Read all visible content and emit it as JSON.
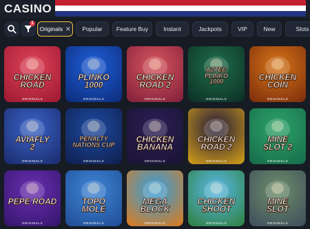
{
  "header": {
    "title": "CASINO"
  },
  "filters": {
    "badge": "1",
    "chips": [
      {
        "label": "Originals",
        "active": true
      },
      {
        "label": "Popular",
        "active": false
      },
      {
        "label": "Feature Buy",
        "active": false
      },
      {
        "label": "Instant",
        "active": false
      },
      {
        "label": "Jackpots",
        "active": false
      },
      {
        "label": "VIP",
        "active": false
      },
      {
        "label": "New",
        "active": false
      },
      {
        "label": "Slots",
        "active": false
      }
    ]
  },
  "games": [
    {
      "title": "CHICKEN\nROAD",
      "tag": "ORIGINALS",
      "bg": "#e0445a",
      "bg2": "#9c1830"
    },
    {
      "title": "PLINKO\n1000",
      "tag": "ORIGINALS",
      "bg": "#1f5fd8",
      "bg2": "#0c2b7a"
    },
    {
      "title": "CHICKEN\nROAD 2",
      "tag": "ORIGINALS",
      "bg": "#d9565e",
      "bg2": "#7f1f3a"
    },
    {
      "title": "AZTEC\nPLINKO\n1000",
      "tag": "ORIGINALS",
      "bg": "#1f6e4c",
      "bg2": "#0c2e24"
    },
    {
      "title": "CHICKEN\nCOIN",
      "tag": "ORIGINALS",
      "bg": "#d77518",
      "bg2": "#7a2c0c"
    },
    {
      "title": "AVIAFLY\n2",
      "tag": "ORIGINALS",
      "bg": "#3a63c9",
      "bg2": "#1a2b6b"
    },
    {
      "title": "PENALTY\nNATIONS CUP",
      "tag": "ORIGINALS",
      "bg": "#1d4aa0",
      "bg2": "#0f1f4e"
    },
    {
      "title": "CHICKEN\nBANANA",
      "tag": "ORIGINALS",
      "bg": "#2b1e56",
      "bg2": "#1a1433"
    },
    {
      "title": "CHICKEN\nROAD 2",
      "tag": "ORIGINALS",
      "bg": "#231a3a",
      "bg2": "#d4a017"
    },
    {
      "title": "MINE\nSLOT 2",
      "tag": "ORIGINALS",
      "bg": "#2da36a",
      "bg2": "#166b49"
    },
    {
      "title": "PEPE ROAD",
      "tag": "ORIGINALS",
      "bg": "#6a2fb3",
      "bg2": "#34156b"
    },
    {
      "title": "TOPO\nMOLE",
      "tag": "ORIGINALS",
      "bg": "#3f86d6",
      "bg2": "#1f4c94"
    },
    {
      "title": "MEGA BLOCK",
      "tag": "ORIGINALS",
      "bg": "#2f9ee0",
      "bg2": "#e07b1a"
    },
    {
      "title": "CHICKEN\nSHOOT",
      "tag": "ORIGINALS",
      "bg": "#58b8e8",
      "bg2": "#2e7f3c"
    },
    {
      "title": "MINE\nSLOT",
      "tag": "ORIGINALS",
      "bg": "#6d8e6a",
      "bg2": "#3e4d5c"
    }
  ]
}
